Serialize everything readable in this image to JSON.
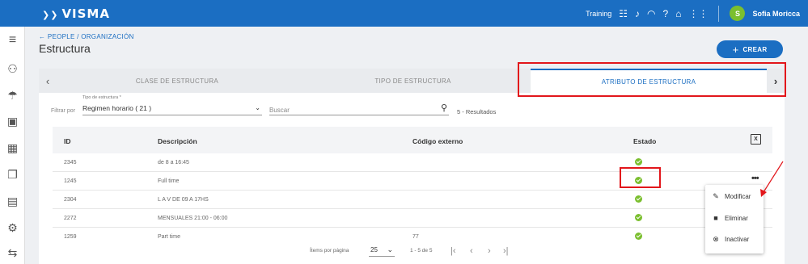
{
  "brand": {
    "logo_text": "VISMA",
    "primary_color": "#1b6ec2"
  },
  "topbar": {
    "training_label": "Training",
    "icons": [
      "database-icon",
      "bell-icon",
      "headset-icon",
      "help-icon",
      "home-icon",
      "apps-grid-icon"
    ],
    "user_initial": "S",
    "user_name": "Sofia Moricca"
  },
  "sidebar": {
    "items": [
      "menu-icon",
      "people-group-icon",
      "beach-icon",
      "calendar-icon",
      "spreadsheet-icon",
      "documents-icon",
      "clipboard-icon",
      "settings-icon",
      "transfer-icon"
    ]
  },
  "header": {
    "breadcrumb": "← PEOPLE / ORGANIZACIÓN",
    "title": "Estructura",
    "create_label": "CREAR"
  },
  "tabs": {
    "items": [
      "CLASE DE ESTRUCTURA",
      "TIPO DE ESTRUCTURA",
      "ATRIBUTO DE ESTRUCTURA"
    ],
    "active": "ATRIBUTO DE ESTRUCTURA"
  },
  "filters": {
    "filter_label": "Filtrar por",
    "select_caption": "Tipo de estructura *",
    "select_value": "Regimen horario ( 21 )",
    "search_placeholder": "Buscar",
    "results_text": "5 - Resultados"
  },
  "table": {
    "columns": [
      "ID",
      "Descripción",
      "Código externo",
      "Estado"
    ],
    "rows": [
      {
        "id": "2345",
        "descripcion": "de 8 a 16:45",
        "codigo": "",
        "estado": "active"
      },
      {
        "id": "1245",
        "descripcion": "Full time",
        "codigo": "",
        "estado": "active"
      },
      {
        "id": "2304",
        "descripcion": "L A V DE 09 A 17HS",
        "codigo": "",
        "estado": "active"
      },
      {
        "id": "2272",
        "descripcion": "MENSUALES 21:00 - 06:00",
        "codigo": "",
        "estado": "active"
      },
      {
        "id": "1259",
        "descripcion": "Part time",
        "codigo": "77",
        "estado": "active"
      }
    ]
  },
  "pagination": {
    "items_per_page_label": "Ítems por página",
    "items_per_page": "25",
    "range_text": "1 - 5 de 5"
  },
  "context_menu": {
    "items": [
      "Modificar",
      "Eliminar",
      "Inactivar"
    ]
  },
  "status_color": "#7bbf2f",
  "annotation_color": "#e2161b"
}
